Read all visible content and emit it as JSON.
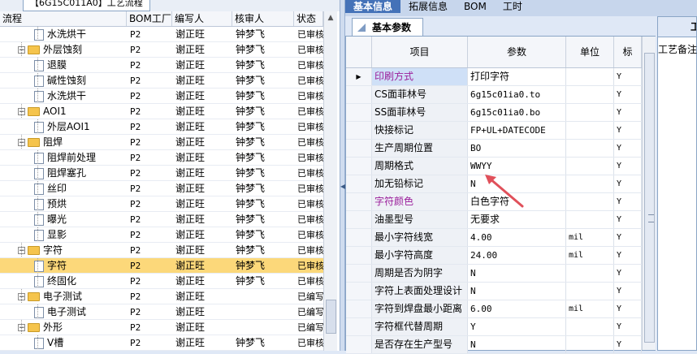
{
  "left_panel": {
    "tab_label": "【6G15C011A0】工艺流程",
    "columns": [
      "流程",
      "BOM工厂",
      "编写人",
      "核审人",
      "状态"
    ],
    "rows": [
      {
        "depth": 2,
        "type": "doc",
        "name": "水洗烘干",
        "bom": "P2",
        "writer": "谢正旺",
        "reviewer": "钟梦飞",
        "status": "已审核"
      },
      {
        "depth": 1,
        "type": "folder",
        "name": "外层蚀刻",
        "bom": "P2",
        "writer": "谢正旺",
        "reviewer": "钟梦飞",
        "status": "已审核"
      },
      {
        "depth": 2,
        "type": "doc",
        "name": "退膜",
        "bom": "P2",
        "writer": "谢正旺",
        "reviewer": "钟梦飞",
        "status": "已审核"
      },
      {
        "depth": 2,
        "type": "doc",
        "name": "碱性蚀刻",
        "bom": "P2",
        "writer": "谢正旺",
        "reviewer": "钟梦飞",
        "status": "已审核"
      },
      {
        "depth": 2,
        "type": "doc",
        "name": "水洗烘干",
        "bom": "P2",
        "writer": "谢正旺",
        "reviewer": "钟梦飞",
        "status": "已审核"
      },
      {
        "depth": 1,
        "type": "folder",
        "name": "AOI1",
        "bom": "P2",
        "writer": "谢正旺",
        "reviewer": "钟梦飞",
        "status": "已审核"
      },
      {
        "depth": 2,
        "type": "doc",
        "name": "外层AOI1",
        "bom": "P2",
        "writer": "谢正旺",
        "reviewer": "钟梦飞",
        "status": "已审核"
      },
      {
        "depth": 1,
        "type": "folder",
        "name": "阻焊",
        "bom": "P2",
        "writer": "谢正旺",
        "reviewer": "钟梦飞",
        "status": "已审核"
      },
      {
        "depth": 2,
        "type": "doc",
        "name": "阻焊前处理",
        "bom": "P2",
        "writer": "谢正旺",
        "reviewer": "钟梦飞",
        "status": "已审核"
      },
      {
        "depth": 2,
        "type": "doc",
        "name": "阻焊塞孔",
        "bom": "P2",
        "writer": "谢正旺",
        "reviewer": "钟梦飞",
        "status": "已审核"
      },
      {
        "depth": 2,
        "type": "doc",
        "name": "丝印",
        "bom": "P2",
        "writer": "谢正旺",
        "reviewer": "钟梦飞",
        "status": "已审核"
      },
      {
        "depth": 2,
        "type": "doc",
        "name": "预烘",
        "bom": "P2",
        "writer": "谢正旺",
        "reviewer": "钟梦飞",
        "status": "已审核"
      },
      {
        "depth": 2,
        "type": "doc",
        "name": "曝光",
        "bom": "P2",
        "writer": "谢正旺",
        "reviewer": "钟梦飞",
        "status": "已审核"
      },
      {
        "depth": 2,
        "type": "doc",
        "name": "显影",
        "bom": "P2",
        "writer": "谢正旺",
        "reviewer": "钟梦飞",
        "status": "已审核"
      },
      {
        "depth": 1,
        "type": "folder",
        "name": "字符",
        "bom": "P2",
        "writer": "谢正旺",
        "reviewer": "钟梦飞",
        "status": "已审核"
      },
      {
        "depth": 2,
        "type": "doc",
        "name": "字符",
        "bom": "P2",
        "writer": "谢正旺",
        "reviewer": "钟梦飞",
        "status": "已审核",
        "selected": true
      },
      {
        "depth": 2,
        "type": "doc",
        "name": "终固化",
        "bom": "P2",
        "writer": "谢正旺",
        "reviewer": "钟梦飞",
        "status": "已审核"
      },
      {
        "depth": 1,
        "type": "folder",
        "name": "电子测试",
        "bom": "P2",
        "writer": "谢正旺",
        "reviewer": "",
        "status": "已编写"
      },
      {
        "depth": 2,
        "type": "doc",
        "name": "电子测试",
        "bom": "P2",
        "writer": "谢正旺",
        "reviewer": "",
        "status": "已编写"
      },
      {
        "depth": 1,
        "type": "folder",
        "name": "外形",
        "bom": "P2",
        "writer": "谢正旺",
        "reviewer": "",
        "status": "已编写"
      },
      {
        "depth": 2,
        "type": "doc",
        "name": "V槽",
        "bom": "P2",
        "writer": "谢正旺",
        "reviewer": "钟梦飞",
        "status": "已审核"
      }
    ]
  },
  "top_tabs": [
    "基本信息",
    "拓展信息",
    "BOM",
    "工时"
  ],
  "sub_tab": "基本参数",
  "grid": {
    "columns": [
      "项目",
      "参数",
      "单位",
      "标"
    ],
    "rows": [
      {
        "item": "印刷方式",
        "value": "打印字符",
        "unit": "",
        "flag": "Y",
        "highlight": true,
        "item_color": "#9b1e9b",
        "current": true
      },
      {
        "item": "CS面菲林号",
        "value": "6g15c01ia0.to",
        "unit": "",
        "flag": "Y"
      },
      {
        "item": "SS面菲林号",
        "value": "6g15c01ia0.bo",
        "unit": "",
        "flag": "Y"
      },
      {
        "item": "快接标记",
        "value": "FP+UL+DATECODE",
        "unit": "",
        "flag": "Y"
      },
      {
        "item": "生产周期位置",
        "value": "BO",
        "unit": "",
        "flag": "Y"
      },
      {
        "item": "周期格式",
        "value": "WWYY",
        "unit": "",
        "flag": "Y"
      },
      {
        "item": "加无铅标记",
        "value": "N",
        "unit": "",
        "flag": "Y"
      },
      {
        "item": "字符颜色",
        "value": "白色字符",
        "unit": "",
        "flag": "Y",
        "item_color": "#9b1e9b"
      },
      {
        "item": "油墨型号",
        "value": "无要求",
        "unit": "",
        "flag": "Y"
      },
      {
        "item": "最小字符线宽",
        "value": "4.00",
        "unit": "mil",
        "flag": "Y"
      },
      {
        "item": "最小字符高度",
        "value": "24.00",
        "unit": "mil",
        "flag": "Y"
      },
      {
        "item": "周期是否为阴字",
        "value": "N",
        "unit": "",
        "flag": "Y"
      },
      {
        "item": "字符上表面处理设计",
        "value": "N",
        "unit": "",
        "flag": "Y"
      },
      {
        "item": "字符到焊盘最小距离",
        "value": "6.00",
        "unit": "mil",
        "flag": "Y"
      },
      {
        "item": "字符框代替周期",
        "value": "Y",
        "unit": "",
        "flag": "Y"
      },
      {
        "item": "是否存在生产型号",
        "value": "N",
        "unit": "",
        "flag": "Y"
      }
    ]
  },
  "right_panel": {
    "tab": "工",
    "label": "工艺备注"
  },
  "colors": {
    "arrow": "#e0505a",
    "selected_row": "#fcd87a",
    "active_tab": "#4472b8"
  }
}
